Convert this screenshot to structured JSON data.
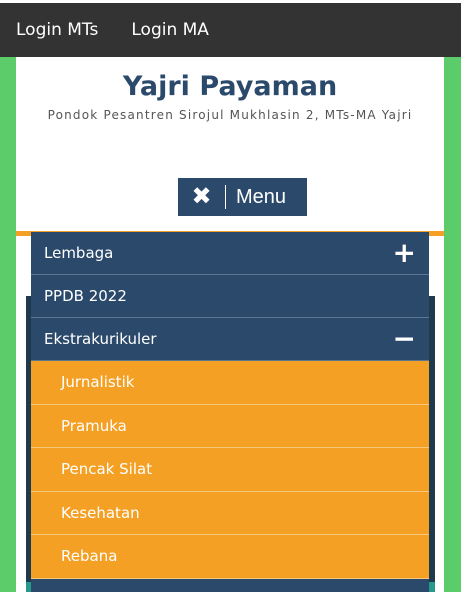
{
  "topbar": {
    "links": [
      "Login MTs",
      "Login MA"
    ]
  },
  "site": {
    "title": "Yajri Payaman",
    "description": "Pondok Pesantren Sirojul Mukhlasin 2, MTs-MA Yajri"
  },
  "menu_toggle": {
    "icon": "✖",
    "label": "Menu"
  },
  "menu": {
    "items": [
      {
        "label": "Lembaga",
        "toggle": "+"
      },
      {
        "label": "PPDB 2022"
      },
      {
        "label": "Ekstrakurikuler",
        "toggle": "−"
      }
    ],
    "submenu": [
      "Jurnalistik",
      "Pramuka",
      "Pencak Silat",
      "Kesehatan",
      "Rebana"
    ]
  },
  "colors": {
    "navy": "#2b4a6b",
    "orange": "#f4a024",
    "green": "#5ccb6a",
    "topbar": "#333333"
  }
}
